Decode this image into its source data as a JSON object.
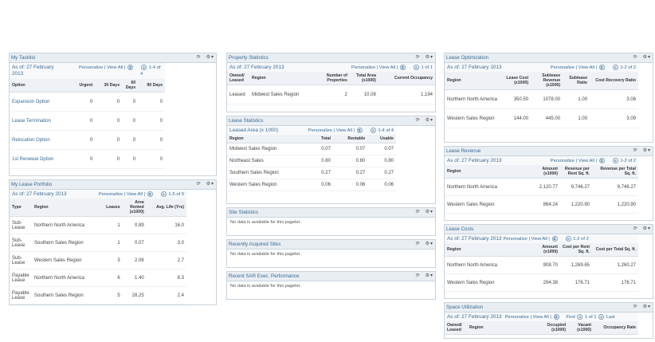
{
  "icons": {
    "refresh": "⟳",
    "gear": "⚙▾",
    "popout": "⧉",
    "nav": "⊕"
  },
  "tasklist": {
    "title": "My Tasklist",
    "asof": "As of: 27 February 2013",
    "personalize": "Personalize",
    "viewall": "View All",
    "count": "1-4 of 4",
    "headers": [
      "Option",
      "Urgent",
      "30 Days",
      "60 Days",
      "90 Days"
    ],
    "rows": [
      [
        "Expansion Option",
        "0",
        "0",
        "0",
        "0"
      ],
      [
        "Lease Termination",
        "0",
        "0",
        "0",
        "0"
      ],
      [
        "Relocation Option",
        "0",
        "0",
        "0",
        "0"
      ],
      [
        "1st Renewal Option",
        "0",
        "0",
        "0",
        "0"
      ]
    ]
  },
  "portfolio": {
    "title": "My Lease Portfolio",
    "asof": "As of: 27 February 2013",
    "personalize": "Personalize",
    "viewall": "View All",
    "count": "1-5 of 9",
    "headers": [
      "Type",
      "Region",
      "Leases",
      "Area Rented (x1000)",
      "Avg. Life (Yrs)"
    ],
    "rows": [
      [
        "Sub-Lease",
        "Northern North America",
        "1",
        "0.89",
        "16.0"
      ],
      [
        "Sub-Lease",
        "Southern Sales Region",
        "1",
        "0.07",
        "3.0"
      ],
      [
        "Sub-Lease",
        "Western Sales Region",
        "3",
        "2.06",
        "2.7"
      ],
      [
        "Payable Lease",
        "Northern North America",
        "6",
        "1.40",
        "8.3"
      ],
      [
        "Payable Lease",
        "Southern Sales Region",
        "5",
        "28.25",
        "2.4"
      ]
    ]
  },
  "property": {
    "title": "Property Statistics",
    "asof": "As of: 27 February 2013",
    "personalize": "Personalize",
    "viewall": "View All",
    "count": "1 of 1",
    "headers": [
      "Owned/ Leased",
      "Region",
      "Number of Properties",
      "Total Area (x1000)",
      "Current Occupancy"
    ],
    "rows": [
      [
        "Leased",
        "Midwest Sales Region",
        "2",
        "10.08",
        "1,194"
      ]
    ]
  },
  "leasestats": {
    "title": "Lease Statistics",
    "area": "Leased Area (x 1000)",
    "personalize": "Personalize",
    "viewall": "View All",
    "count": "1-4 of 4",
    "headers": [
      "Region",
      "Total",
      "Rentable",
      "Usable"
    ],
    "rows": [
      [
        "Midwest Sales Region",
        "0.07",
        "0.07",
        "0.07"
      ],
      [
        "Northeast Sales",
        "0.80",
        "0.80",
        "0.80"
      ],
      [
        "Southern Sales Region",
        "0.27",
        "0.27",
        "0.27"
      ],
      [
        "Western Sales Region",
        "0.06",
        "0.06",
        "0.06"
      ]
    ]
  },
  "sitestats": {
    "title": "Site Statistics",
    "nodata": "No data is available for this pagelet."
  },
  "recent": {
    "title": "Recently Acquired Sites",
    "nodata": "No data is available for this pagelet."
  },
  "sar": {
    "title": "Recent SAR Exec. Performance",
    "nodata": "No data is available for this pagelet."
  },
  "optimization": {
    "title": "Lease Optimization",
    "asof": "As of: 27 February 2013",
    "personalize": "Personalize",
    "viewall": "View All",
    "count": "1-2 of 2",
    "headers": [
      "Region",
      "Lease Cost (x1000)",
      "Sublease Revenue (x1000)",
      "Sublease Ratio",
      "Cost Recovery Ratio"
    ],
    "rows": [
      [
        "Northern North America",
        "350.50",
        "1078.00",
        "1.00",
        "3.08"
      ],
      [
        "Western Sales Region",
        "144.00",
        "445.00",
        "1.00",
        "3.09"
      ]
    ]
  },
  "revenue": {
    "title": "Lease Revenue",
    "asof": "As of: 27 February 2013",
    "personalize": "Personalize",
    "viewall": "View All",
    "count": "1-2 of 2",
    "headers": [
      "Region",
      "Amount (x1000)",
      "Revenue per Rent Sq. ft.",
      "Revenue per Total Sq. ft."
    ],
    "rows": [
      [
        "Northern North America",
        "2,120.77",
        "9,746.27",
        "9,746.27"
      ],
      [
        "Western Sales Region",
        "864.24",
        "1,220.90",
        "1,220.90"
      ]
    ]
  },
  "costs": {
    "title": "Lease Costs",
    "asof": "As of: 27 February 2013",
    "personalize": "Personalize",
    "viewall": "View All",
    "count": "1-2 of 2",
    "headers": [
      "Region",
      "Amount (x1000)",
      "Cost per Rent Sq. ft.",
      "Cost per Total Sq. ft."
    ],
    "rows": [
      [
        "Northern North America",
        "908.70",
        "1,269.65",
        "1,260.27"
      ],
      [
        "Western Sales Region",
        "294.38",
        "176.71",
        "176.71"
      ]
    ]
  },
  "space": {
    "title": "Space Utilization",
    "asof": "As of: 27 February 2013",
    "personalize": "Personalize",
    "viewall": "View All",
    "first": "First",
    "count": "1 of 1",
    "last": "Last",
    "headers": [
      "Owned/ Leased",
      "Region",
      "Occupied (x1000)",
      "Vacant (x1000)",
      "Occupancy Rate"
    ]
  }
}
